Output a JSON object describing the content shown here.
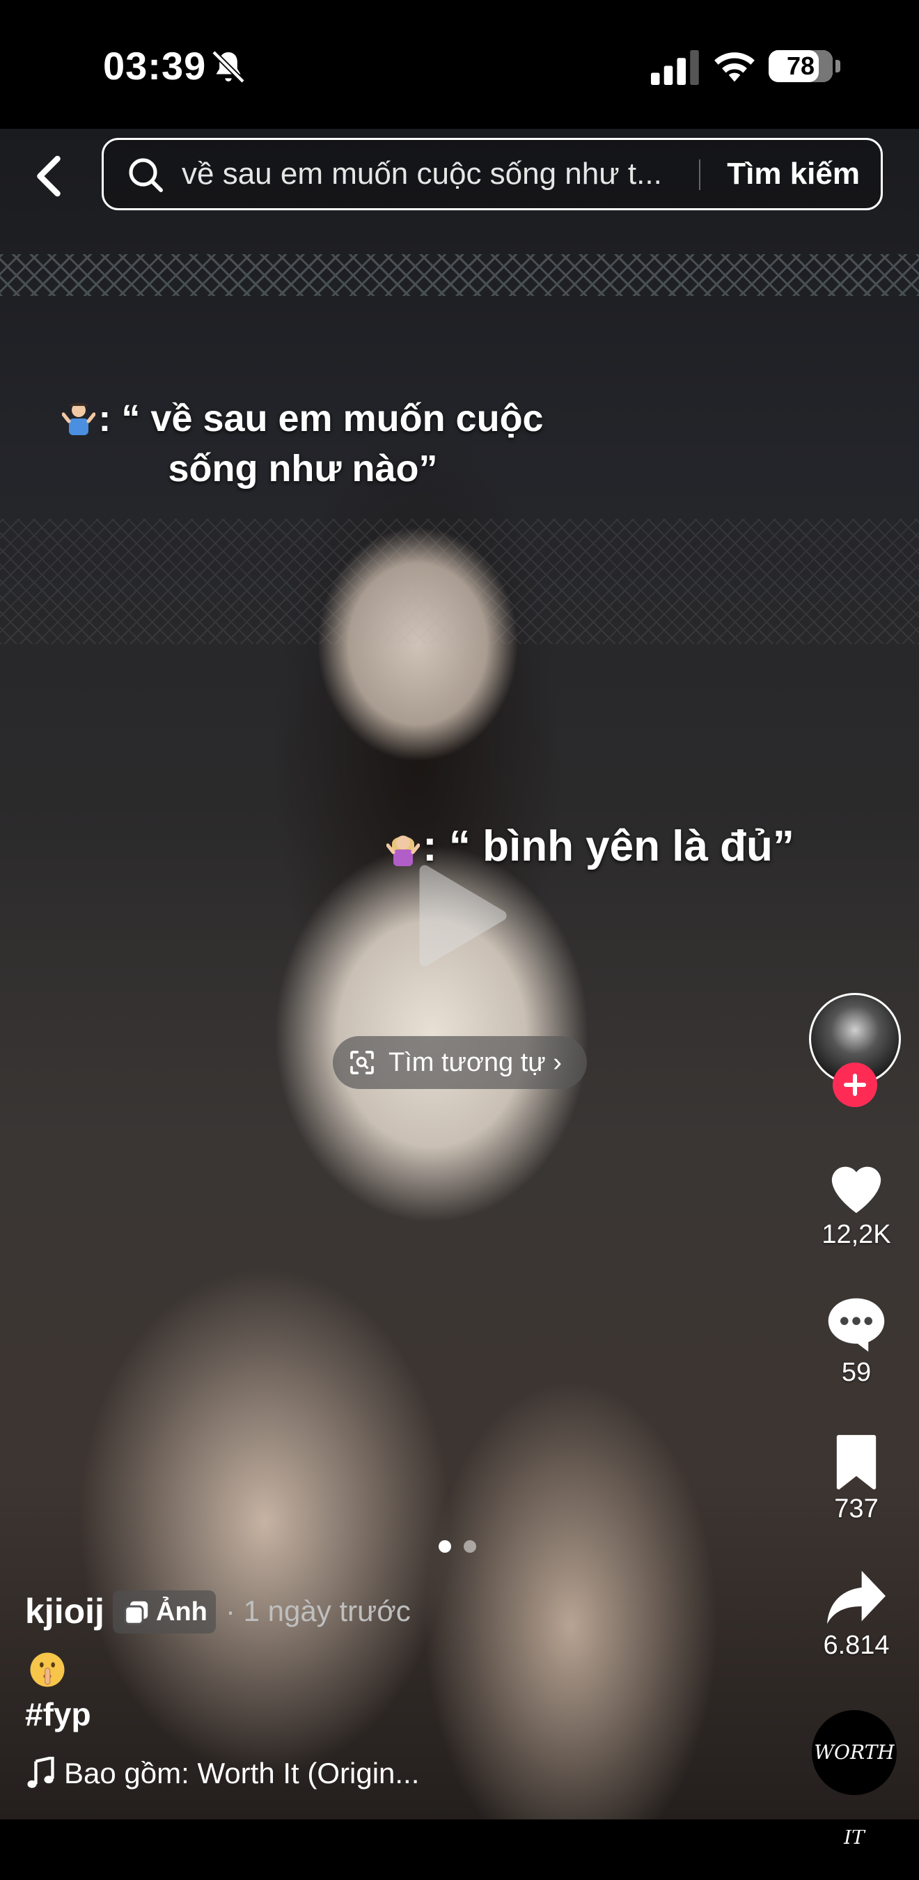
{
  "status_bar": {
    "time": "03:39",
    "battery_level": "78"
  },
  "search": {
    "query": "về sau em muốn cuộc sống như t...",
    "button_label": "Tìm kiếm"
  },
  "captions": {
    "line_1": "“ về sau em muốn cuộc sống như nào”",
    "line_1_prefix": ": ",
    "line_2": "“ bình yên là đủ”",
    "line_2_prefix": ": "
  },
  "similar_button": {
    "label": "Tìm tương tự"
  },
  "actions": {
    "likes": "12,2K",
    "comments": "59",
    "saves": "737",
    "shares": "6.814"
  },
  "carousel": {
    "count": 2,
    "active_index": 0
  },
  "post": {
    "author": "kjioij",
    "badge_label": "Ảnh",
    "time_ago": "· 1 ngày trước",
    "emoji": "🤫",
    "hashtag": "#fyp",
    "music": "Bao gồm: Worth It (Origin..."
  },
  "sound_disc": {
    "label": "WORTH IT"
  },
  "colors": {
    "follow_red": "#fe2c55",
    "background": "#000000"
  },
  "icons": [
    "back-icon",
    "search-icon",
    "bell-muted-icon",
    "signal-icon",
    "wifi-icon",
    "scan-icon",
    "heart-icon",
    "comment-icon",
    "bookmark-icon",
    "share-icon",
    "photo-icon",
    "music-note-icon",
    "play-icon",
    "plus-icon"
  ]
}
